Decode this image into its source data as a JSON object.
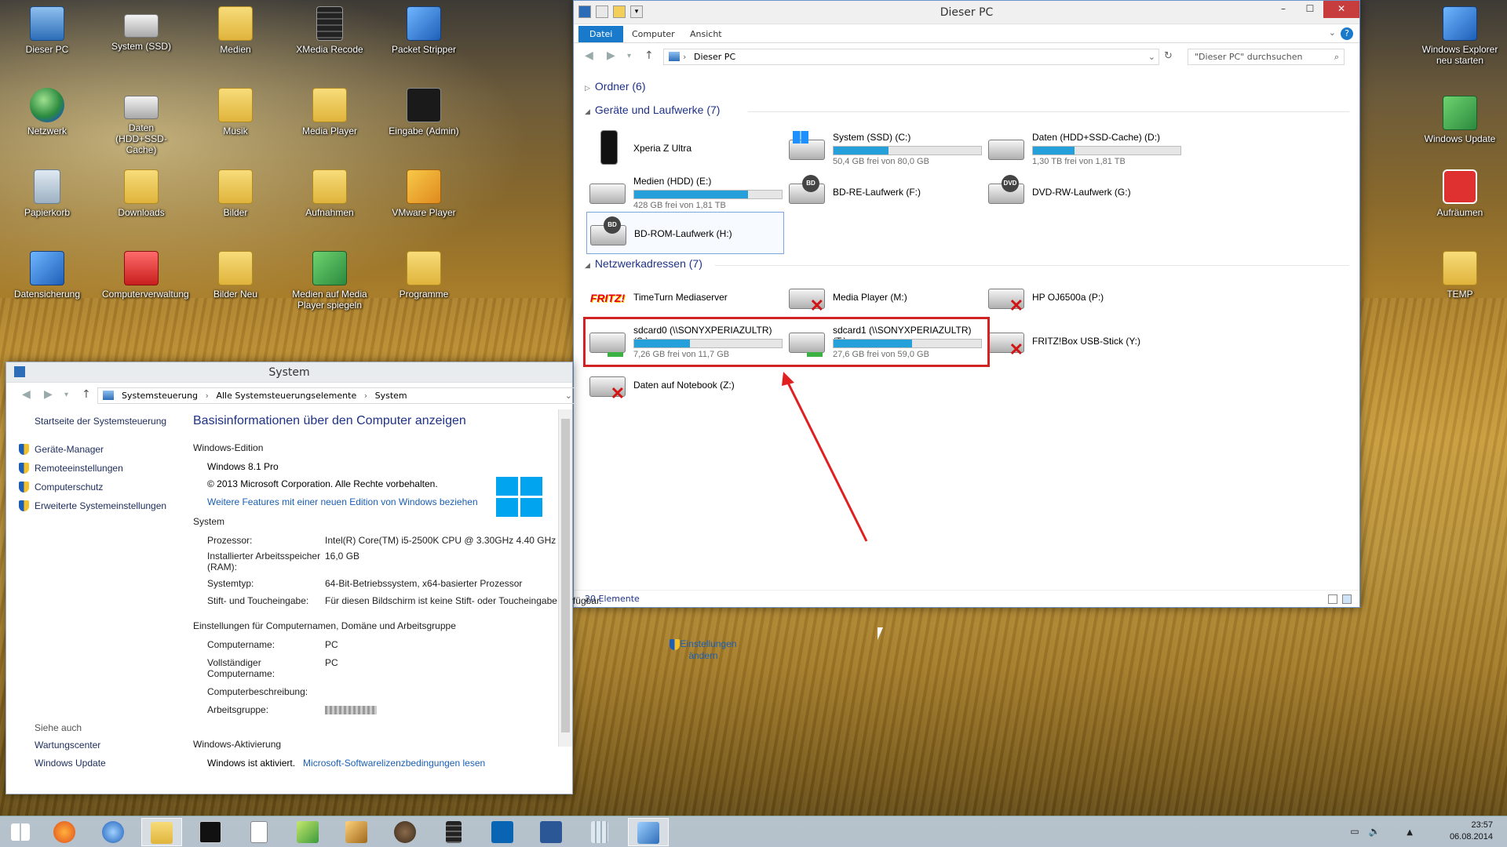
{
  "desktop": {
    "icons_left": [
      {
        "label": "Dieser PC",
        "kind": "pc"
      },
      {
        "label": "System (SSD)",
        "kind": "drive"
      },
      {
        "label": "Medien",
        "kind": "folder"
      },
      {
        "label": "XMedia Recode",
        "kind": "film"
      },
      {
        "label": "Packet Stripper",
        "kind": "blue"
      },
      {
        "label": "Netzwerk",
        "kind": "globe"
      },
      {
        "label": "Daten (HDD+SSD-Cache)",
        "kind": "drive"
      },
      {
        "label": "Musik",
        "kind": "folder"
      },
      {
        "label": "Media Player",
        "kind": "folder"
      },
      {
        "label": "Eingabe (Admin)",
        "kind": "dark"
      },
      {
        "label": "Papierkorb",
        "kind": "bin"
      },
      {
        "label": "Downloads",
        "kind": "folder"
      },
      {
        "label": "Bilder",
        "kind": "folder"
      },
      {
        "label": "Aufnahmen",
        "kind": "folder"
      },
      {
        "label": "VMware Player",
        "kind": "vm"
      },
      {
        "label": "Datensicherung",
        "kind": "blue"
      },
      {
        "label": "Computerverwaltung",
        "kind": "red"
      },
      {
        "label": "Bilder Neu",
        "kind": "folder"
      },
      {
        "label": "Medien auf Media Player spiegeln",
        "kind": "green"
      },
      {
        "label": "Programme",
        "kind": "folder"
      }
    ],
    "icons_right": [
      {
        "label": "Windows Explorer neu starten",
        "kind": "blue"
      },
      {
        "label": "Windows Update",
        "kind": "green"
      },
      {
        "label": "Aufräumen",
        "kind": "power"
      },
      {
        "label": "TEMP",
        "kind": "folder"
      }
    ]
  },
  "explorer": {
    "title": "Dieser PC",
    "ribbon_tabs": [
      "Datei",
      "Computer",
      "Ansicht"
    ],
    "address": "Dieser PC",
    "search_placeholder": "\"Dieser PC\" durchsuchen",
    "groups": {
      "folders": "Ordner (6)",
      "devices": "Geräte und Laufwerke (7)",
      "network": "Netzwerkadressen (7)"
    },
    "devices": [
      {
        "name": "Xperia Z Ultra",
        "icon": "phone-icon"
      },
      {
        "name": "System (SSD) (C:)",
        "free": "50,4 GB frei von 80,0 GB",
        "used_fraction": 0.37,
        "icon": "system-drive-icon"
      },
      {
        "name": "Daten (HDD+SSD-Cache) (D:)",
        "free": "1,30 TB frei von 1,81 TB",
        "used_fraction": 0.28,
        "icon": "hdd-icon"
      },
      {
        "name": "Medien (HDD) (E:)",
        "free": "428 GB frei von 1,81 TB",
        "used_fraction": 0.77,
        "icon": "hdd-icon"
      },
      {
        "name": "BD-RE-Laufwerk (F:)",
        "icon": "bd-drive-icon",
        "badge": "BD"
      },
      {
        "name": "DVD-RW-Laufwerk (G:)",
        "icon": "dvd-drive-icon",
        "badge": "DVD"
      },
      {
        "name": "BD-ROM-Laufwerk (H:)",
        "icon": "bd-drive-icon",
        "badge": "BD"
      }
    ],
    "network": [
      {
        "name": "TimeTurn Mediaserver",
        "icon": "fritz-icon",
        "logo": "FRITZ!"
      },
      {
        "name": "Media Player (M:)",
        "icon": "network-drive-disconnected-icon"
      },
      {
        "name": "HP OJ6500a (P:)",
        "icon": "network-drive-disconnected-icon"
      },
      {
        "name": "sdcard0 (\\\\SONYXPERIAZULTR) (S:)",
        "free": "7,26 GB frei von 11,7 GB",
        "used_fraction": 0.38,
        "icon": "network-drive-icon"
      },
      {
        "name": "sdcard1 (\\\\SONYXPERIAZULTR) (T:)",
        "free": "27,6 GB frei von 59,0 GB",
        "used_fraction": 0.53,
        "icon": "network-drive-icon"
      },
      {
        "name": "FRITZ!Box USB-Stick (Y:)",
        "icon": "network-drive-disconnected-icon"
      },
      {
        "name": "Daten auf Notebook (Z:)",
        "icon": "network-drive-disconnected-icon"
      }
    ],
    "status": "20 Elemente"
  },
  "system": {
    "title": "System",
    "breadcrumb": [
      "Systemsteuerung",
      "Alle Systemsteuerungselemente",
      "System"
    ],
    "side_links": {
      "home": "Startseite der Systemsteuerung",
      "device_manager": "Geräte-Manager",
      "remote": "Remoteeinstellungen",
      "protection": "Computerschutz",
      "advanced": "Erweiterte Systemeinstellungen",
      "see_also": "Siehe auch",
      "action_center": "Wartungscenter",
      "windows_update": "Windows Update"
    },
    "heading": "Basisinformationen über den Computer anzeigen",
    "edition_header": "Windows-Edition",
    "edition": "Windows 8.1 Pro",
    "copyright": "© 2013 Microsoft Corporation. Alle Rechte vorbehalten.",
    "features_link": "Weitere Features mit einer neuen Edition von Windows beziehen",
    "system_header": "System",
    "processor_k": "Prozessor:",
    "processor_v": "Intel(R) Core(TM) i5-2500K CPU @ 3.30GHz   4.40 GHz",
    "ram_k": "Installierter Arbeitsspeicher (RAM):",
    "ram_v": "16,0 GB",
    "type_k": "Systemtyp:",
    "type_v": "64-Bit-Betriebssystem, x64-basierter Prozessor",
    "pen_k": "Stift- und Toucheingabe:",
    "pen_v": "Für diesen Bildschirm ist keine Stift- oder Toucheingabe verfügbar.",
    "name_header": "Einstellungen für Computernamen, Domäne und Arbeitsgruppe",
    "cname_k": "Computername:",
    "cname_v": "PC",
    "fullname_k": "Vollständiger Computername:",
    "fullname_v": "PC",
    "desc_k": "Computerbeschreibung:",
    "workgroup_k": "Arbeitsgruppe:",
    "change_link": "Einstellungen ändern",
    "activation_header": "Windows-Aktivierung",
    "activated": "Windows ist aktiviert.",
    "license_link": "Microsoft-Softwarelizenzbedingungen lesen"
  },
  "taskbar": {
    "time": "23:57",
    "date": "06.08.2014"
  }
}
